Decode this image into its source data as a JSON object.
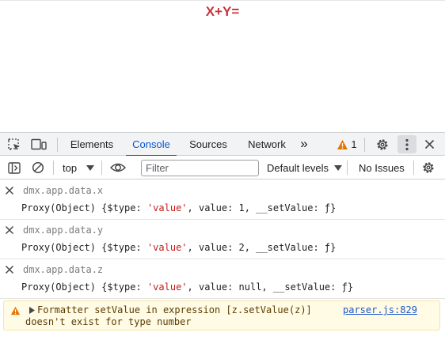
{
  "page": {
    "heading": "X+Y="
  },
  "tabbar": {
    "tabs": [
      "Elements",
      "Console",
      "Sources",
      "Network"
    ],
    "active_tab": "Console",
    "more_tabs": "»",
    "warning_count": "1"
  },
  "toolbar": {
    "context": "top",
    "filter_placeholder": "Filter",
    "levels": "Default levels",
    "issues": "No Issues"
  },
  "console": {
    "messages": [
      {
        "command": "dmx.app.data.x",
        "result_prefix": "Proxy(Object) {$type: ",
        "type_value": "'value'",
        "result_suffix": ", value: 1, __setValue: ƒ}"
      },
      {
        "command": "dmx.app.data.y",
        "result_prefix": "Proxy(Object) {$type: ",
        "type_value": "'value'",
        "result_suffix": ", value: 2, __setValue: ƒ}"
      },
      {
        "command": "dmx.app.data.z",
        "result_prefix": "Proxy(Object) {$type: ",
        "type_value": "'value'",
        "result_suffix": ", value: null, __setValue: ƒ}"
      }
    ],
    "warning": {
      "line1": "Formatter setValue in expression [z.setValue(z)]",
      "line2": "doesn't exist for type number",
      "source": "parser.js:829"
    }
  },
  "colors": {
    "accent": "#0b57d0",
    "heading": "#c7333d",
    "string": "#c41a16",
    "warning_bg": "#fffbe5",
    "warning_icon": "#e37400"
  },
  "icons": [
    "inspect-element-icon",
    "device-toolbar-icon",
    "warning-icon",
    "settings-gear-icon",
    "kebab-menu-icon",
    "close-icon",
    "sidebar-toggle-icon",
    "clear-console-icon",
    "dropdown-caret-icon",
    "eye-icon",
    "expand-triangle-icon"
  ]
}
